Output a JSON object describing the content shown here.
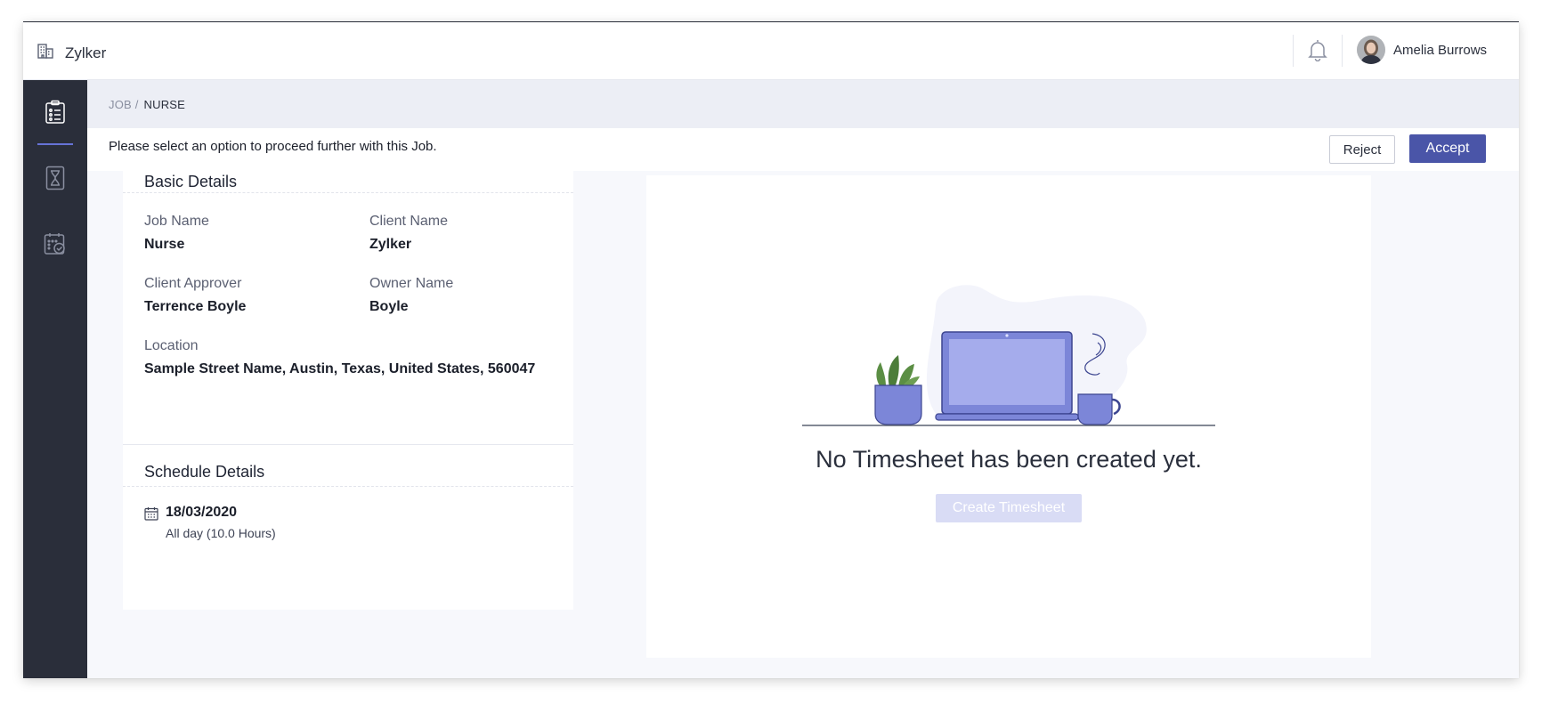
{
  "app": {
    "brand_name": "Zylker",
    "brand_icon": "building-icon",
    "user_name": "Amelia Burrows"
  },
  "breadcrumb": {
    "parent": "JOB /",
    "current": "NURSE"
  },
  "action_bar": {
    "message": "Please select an option to proceed further with this Job.",
    "reject_label": "Reject",
    "accept_label": "Accept"
  },
  "basic_details": {
    "title": "Basic Details",
    "job_name_label": "Job Name",
    "job_name": "Nurse",
    "client_name_label": "Client Name",
    "client_name": "Zylker",
    "client_approver_label": "Client Approver",
    "client_approver": "Terrence Boyle",
    "owner_name_label": "Owner Name",
    "owner_name": "Boyle",
    "location_label": "Location",
    "location": "Sample Street Name, Austin, Texas, United States, 560047"
  },
  "schedule_details": {
    "title": "Schedule Details",
    "date": "18/03/2020",
    "duration": "All day (10.0 Hours)"
  },
  "timesheet": {
    "empty_message": "No Timesheet has been created yet.",
    "create_label": "Create Timesheet"
  },
  "colors": {
    "accent": "#4a55a8",
    "sidebar": "#2a2e3a",
    "illustration": "#7c86d8"
  }
}
